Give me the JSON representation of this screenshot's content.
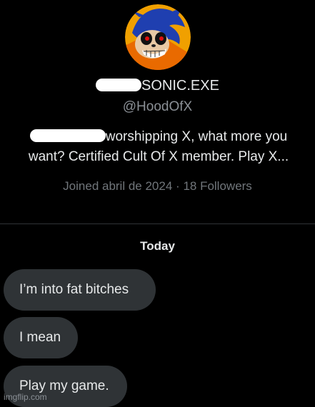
{
  "profile": {
    "display_name_suffix": "SONIC.EXE",
    "handle": "@HoodOfX",
    "bio_line1": "worshipping X, what more you",
    "bio_line2": "want? Certified Cult Of X member. Play X...",
    "joined": "Joined abril de 2024",
    "separator": "·",
    "followers": "18 Followers",
    "avatar_icon": "sonic-exe-avatar"
  },
  "conversation": {
    "day_label": "Today",
    "messages": [
      {
        "text": "I’m into fat bitches"
      },
      {
        "text": "I mean"
      },
      {
        "text": "Play my game."
      }
    ]
  },
  "watermark": "imgflip.com",
  "colors": {
    "background": "#000000",
    "bubble": "#2f3336",
    "text_primary": "#e7e9ea",
    "text_secondary": "#71767b"
  }
}
